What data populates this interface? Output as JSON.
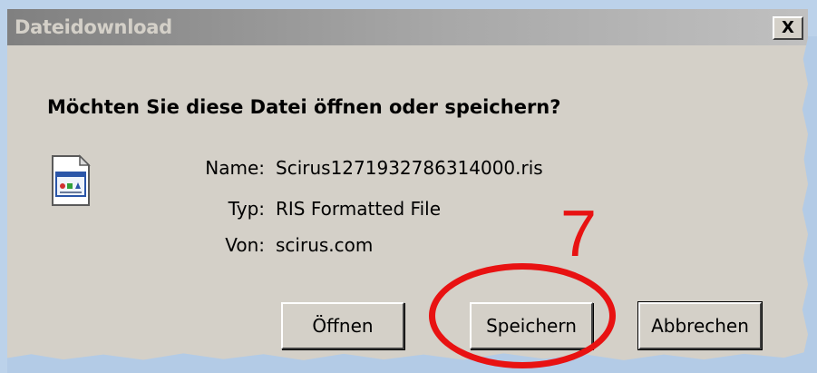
{
  "dialog": {
    "title": "Dateidownload",
    "close_label": "X",
    "question": "Möchten Sie diese Datei öffnen oder speichern?",
    "icon": "ris-file-icon",
    "fields": [
      {
        "label": "Name:",
        "value": "Scirus1271932786314000.ris"
      },
      {
        "label": "Typ:",
        "value": "RIS Formatted File"
      },
      {
        "label": "Von:",
        "value": "scirus.com"
      }
    ],
    "buttons": {
      "open": "Öffnen",
      "save": "Speichern",
      "cancel": "Abbrechen"
    }
  },
  "annotation": {
    "number": "7",
    "color": "#e81212"
  }
}
